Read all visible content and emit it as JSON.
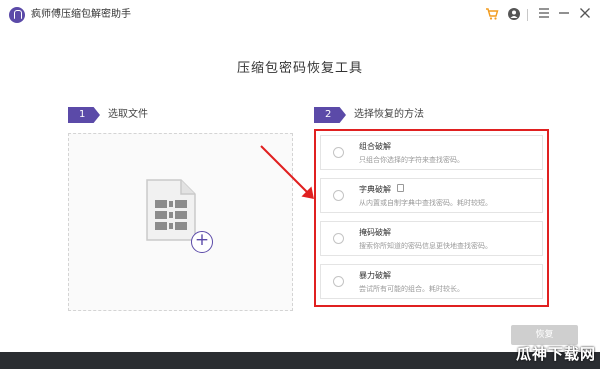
{
  "app": {
    "title": "疯师傅压缩包解密助手",
    "icons": [
      "app-logo",
      "cart-icon",
      "user-icon",
      "menu-icon",
      "minimize-icon",
      "close-icon"
    ]
  },
  "main": {
    "title": "压缩包密码恢复工具"
  },
  "steps": [
    {
      "number": "1",
      "label": "选取文件"
    },
    {
      "number": "2",
      "label": "选择恢复的方法"
    }
  ],
  "methods": [
    {
      "name": "组合破解",
      "desc": "只组合你选择的字符来查找密码。"
    },
    {
      "name": "字典破解",
      "desc": "从内置或自制字典中查找密码。耗时较短。"
    },
    {
      "name": "掩码破解",
      "desc": "搜索你所知道的密码信息更快地查找密码。"
    },
    {
      "name": "暴力破解",
      "desc": "尝试所有可能的组合。耗时较长。"
    }
  ],
  "actions": {
    "recover_label": "恢复"
  },
  "watermark": "瓜神下载网",
  "colors": {
    "accent": "#5b4aa8",
    "highlight": "#e02020",
    "cart": "#f29c1f",
    "disabled_button": "#cfcfcf"
  }
}
